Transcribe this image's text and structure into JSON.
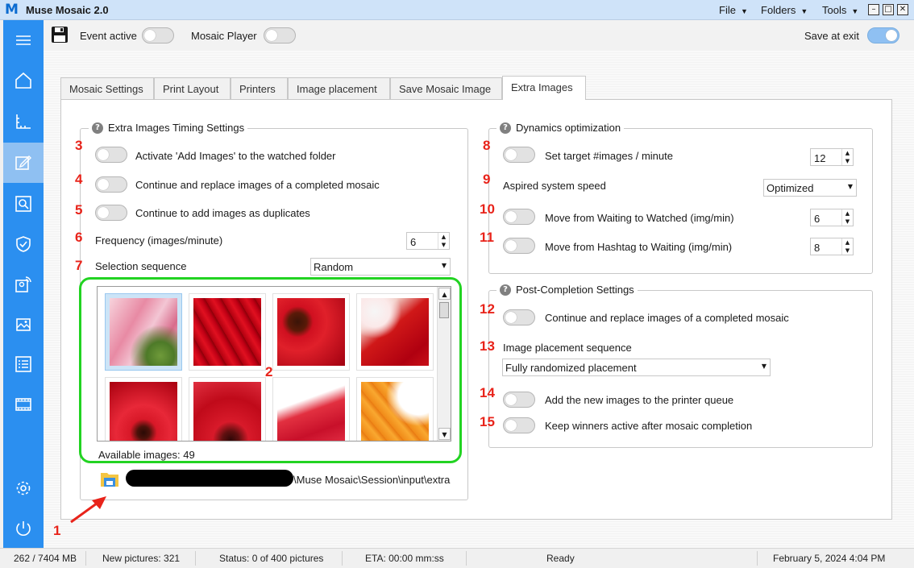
{
  "window": {
    "title": "Muse Mosaic 2.0",
    "menus": [
      "File",
      "Folders",
      "Tools"
    ],
    "buttons": [
      "minimize",
      "maximize",
      "close"
    ]
  },
  "toolbar": {
    "event_active_label": "Event active",
    "event_active_on": false,
    "mosaic_player_label": "Mosaic Player",
    "mosaic_player_on": false,
    "save_at_exit_label": "Save at exit",
    "save_at_exit_on": true
  },
  "sidebar": {
    "items": [
      "menu-icon",
      "home-icon",
      "ruler-icon",
      "edit-icon",
      "search-icon",
      "shield-icon",
      "remote-icon",
      "image-icon",
      "checklist-icon",
      "film-icon",
      "settings-icon",
      "power-icon"
    ],
    "active": "edit-icon"
  },
  "tabs": [
    "Mosaic Settings",
    "Print Layout",
    "Printers",
    "Image placement",
    "Save Mosaic Image",
    "Extra Images"
  ],
  "active_tab": "Extra Images",
  "timing": {
    "title": "Extra Images Timing Settings",
    "activate_label": "Activate 'Add Images' to the watched folder",
    "continue_replace_label": "Continue and replace images of a completed mosaic",
    "duplicates_label": "Continue to add images as duplicates",
    "frequency_label": "Frequency (images/minute)",
    "frequency_value": "6",
    "selection_label": "Selection sequence",
    "selection_value": "Random",
    "available_label": "Available images: 49",
    "folder_path": "\\Muse Mosaic\\Session\\input\\extra"
  },
  "dynamics": {
    "title": "Dynamics optimization",
    "target_label": "Set target #images / minute",
    "target_value": "12",
    "speed_label": "Aspired system speed",
    "speed_value": "Optimized",
    "waiting_label": "Move from Waiting to Watched (img/min)",
    "waiting_value": "6",
    "hashtag_label": "Move from Hashtag to Waiting (img/min)",
    "hashtag_value": "8"
  },
  "post": {
    "title": "Post-Completion Settings",
    "continue_label": "Continue and replace images of a completed mosaic",
    "placement_label": "Image placement sequence",
    "placement_value": "Fully randomized placement",
    "printer_label": "Add the new images to the printer queue",
    "winners_label": "Keep winners active after mosaic completion"
  },
  "annotations": [
    "1",
    "2",
    "3",
    "4",
    "5",
    "6",
    "7",
    "8",
    "9",
    "10",
    "11",
    "12",
    "13",
    "14",
    "15"
  ],
  "statusbar": {
    "memory": "262 / 7404 MB",
    "new_pictures": "New pictures: 321",
    "status": "Status: 0 of 400 pictures",
    "eta": "ETA: 00:00 mm:ss",
    "state": "Ready",
    "datetime": "February 5, 2024  4:04 PM"
  }
}
